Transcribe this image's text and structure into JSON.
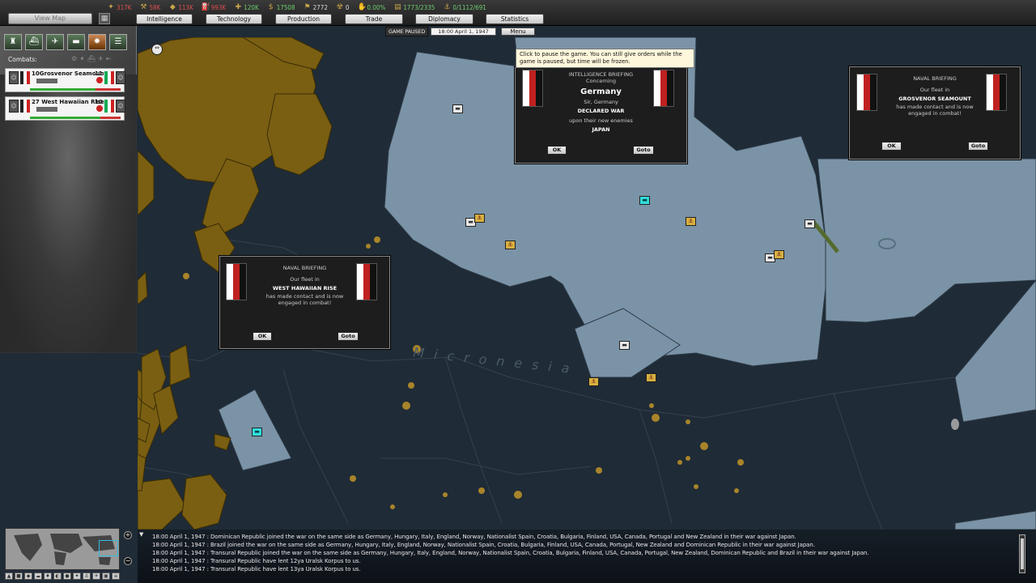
{
  "top": {
    "resources": [
      {
        "icon": "energy-icon",
        "value": "317K",
        "tone": "neg",
        "glyph": "✦"
      },
      {
        "icon": "metal-icon",
        "value": "58K",
        "tone": "neg",
        "glyph": "⚒"
      },
      {
        "icon": "rare-materials-icon",
        "value": "113K",
        "tone": "neg",
        "glyph": "◆"
      },
      {
        "icon": "oil-icon",
        "value": "993K",
        "tone": "neg",
        "glyph": "⛽"
      },
      {
        "icon": "supplies-icon",
        "value": "120K",
        "tone": "pos",
        "glyph": "✚"
      },
      {
        "icon": "money-icon",
        "value": "17508",
        "tone": "pos",
        "glyph": "$"
      },
      {
        "icon": "manpower-icon",
        "value": "2772",
        "tone": "neu",
        "glyph": "⚑"
      },
      {
        "icon": "nuclear-icon",
        "value": "0",
        "tone": "neu",
        "glyph": "☢"
      },
      {
        "icon": "dissent-icon",
        "value": "0.00%",
        "tone": "pos",
        "glyph": "✋"
      },
      {
        "icon": "transport-icon",
        "value": "1773/2335",
        "tone": "pos",
        "glyph": "▤"
      },
      {
        "icon": "convoy-icon",
        "value": "0/1112/691",
        "tone": "pos",
        "glyph": "⚓"
      }
    ],
    "view_map_tab": "View Map",
    "tabs": [
      "Intelligence",
      "Technology",
      "Production",
      "Trade",
      "Diplomacy",
      "Statistics"
    ],
    "paused": "GAME PAUSED",
    "date": "18:00 April 1, 1947",
    "menu": "Menu"
  },
  "left": {
    "combats_label": "Combats:",
    "combats": [
      {
        "name": "Grosvenor Seamount",
        "prefix": "10",
        "count": "11",
        "health": 0.72
      },
      {
        "name": "West Hawaiian Rise",
        "prefix": "27",
        "count": "10",
        "health": 0.78
      }
    ]
  },
  "tooltip": "Click to pause the game. You can still give orders while the game is paused, but time will be frozen.",
  "intel": {
    "header": "INTELLIGENCE BRIEFING",
    "concerning": "Concerning",
    "country": "Germany",
    "sir": "Sir, Germany",
    "declared": "DECLARED WAR",
    "upon": "upon their new enemies",
    "enemy": "JAPAN",
    "ok": "OK",
    "goto": "Goto"
  },
  "naval1": {
    "header": "NAVAL BRIEFING",
    "fleet_in": "Our fleet in",
    "location": "GROSVENOR SEAMOUNT",
    "contact_1": "has made contact and is now",
    "contact_2": "engaged in combat!",
    "ok": "OK",
    "goto": "Goto"
  },
  "naval2": {
    "header": "NAVAL BRIEFING",
    "fleet_in": "Our fleet in",
    "location": "WEST HAWAIIAN RISE",
    "contact_1": "has made contact and is now",
    "contact_2": "engaged in combat!",
    "ok": "OK",
    "goto": "Goto"
  },
  "log": [
    "18:00 April 1, 1947 : Dominican Republic joined the war on the same side as Germany, Hungary, Italy, England, Norway, Nationalist Spain, Croatia, Bulgaria, Finland, USA, Canada, Portugal and New Zealand in their war against Japan.",
    "18:00 April 1, 1947 : Brazil joined the war on the same side as Germany, Hungary, Italy, England, Norway, Nationalist Spain, Croatia, Bulgaria, Finland, USA, Canada, Portugal, New Zealand and Dominican Republic in their war against Japan.",
    "18:00 April 1, 1947 : Transural Republic joined the war on the same side as Germany, Hungary, Italy, England, Norway, Nationalist Spain, Croatia, Bulgaria, Finland, USA, Canada, Portugal, New Zealand, Dominican Republic and Brazil in their war against Japan.",
    "18:00 April 1, 1947 : Transural Republic have lent 12ya Uralsk Korpus to us.",
    "18:00 April 1, 1947 : Transural Republic have lent 13ya Uralsk Korpus to us."
  ],
  "colors": {
    "sea_dark": "#1f2b36",
    "sea_light": "#7a95a8",
    "japan": "#7a5f12",
    "flag_red": "#c02020"
  }
}
